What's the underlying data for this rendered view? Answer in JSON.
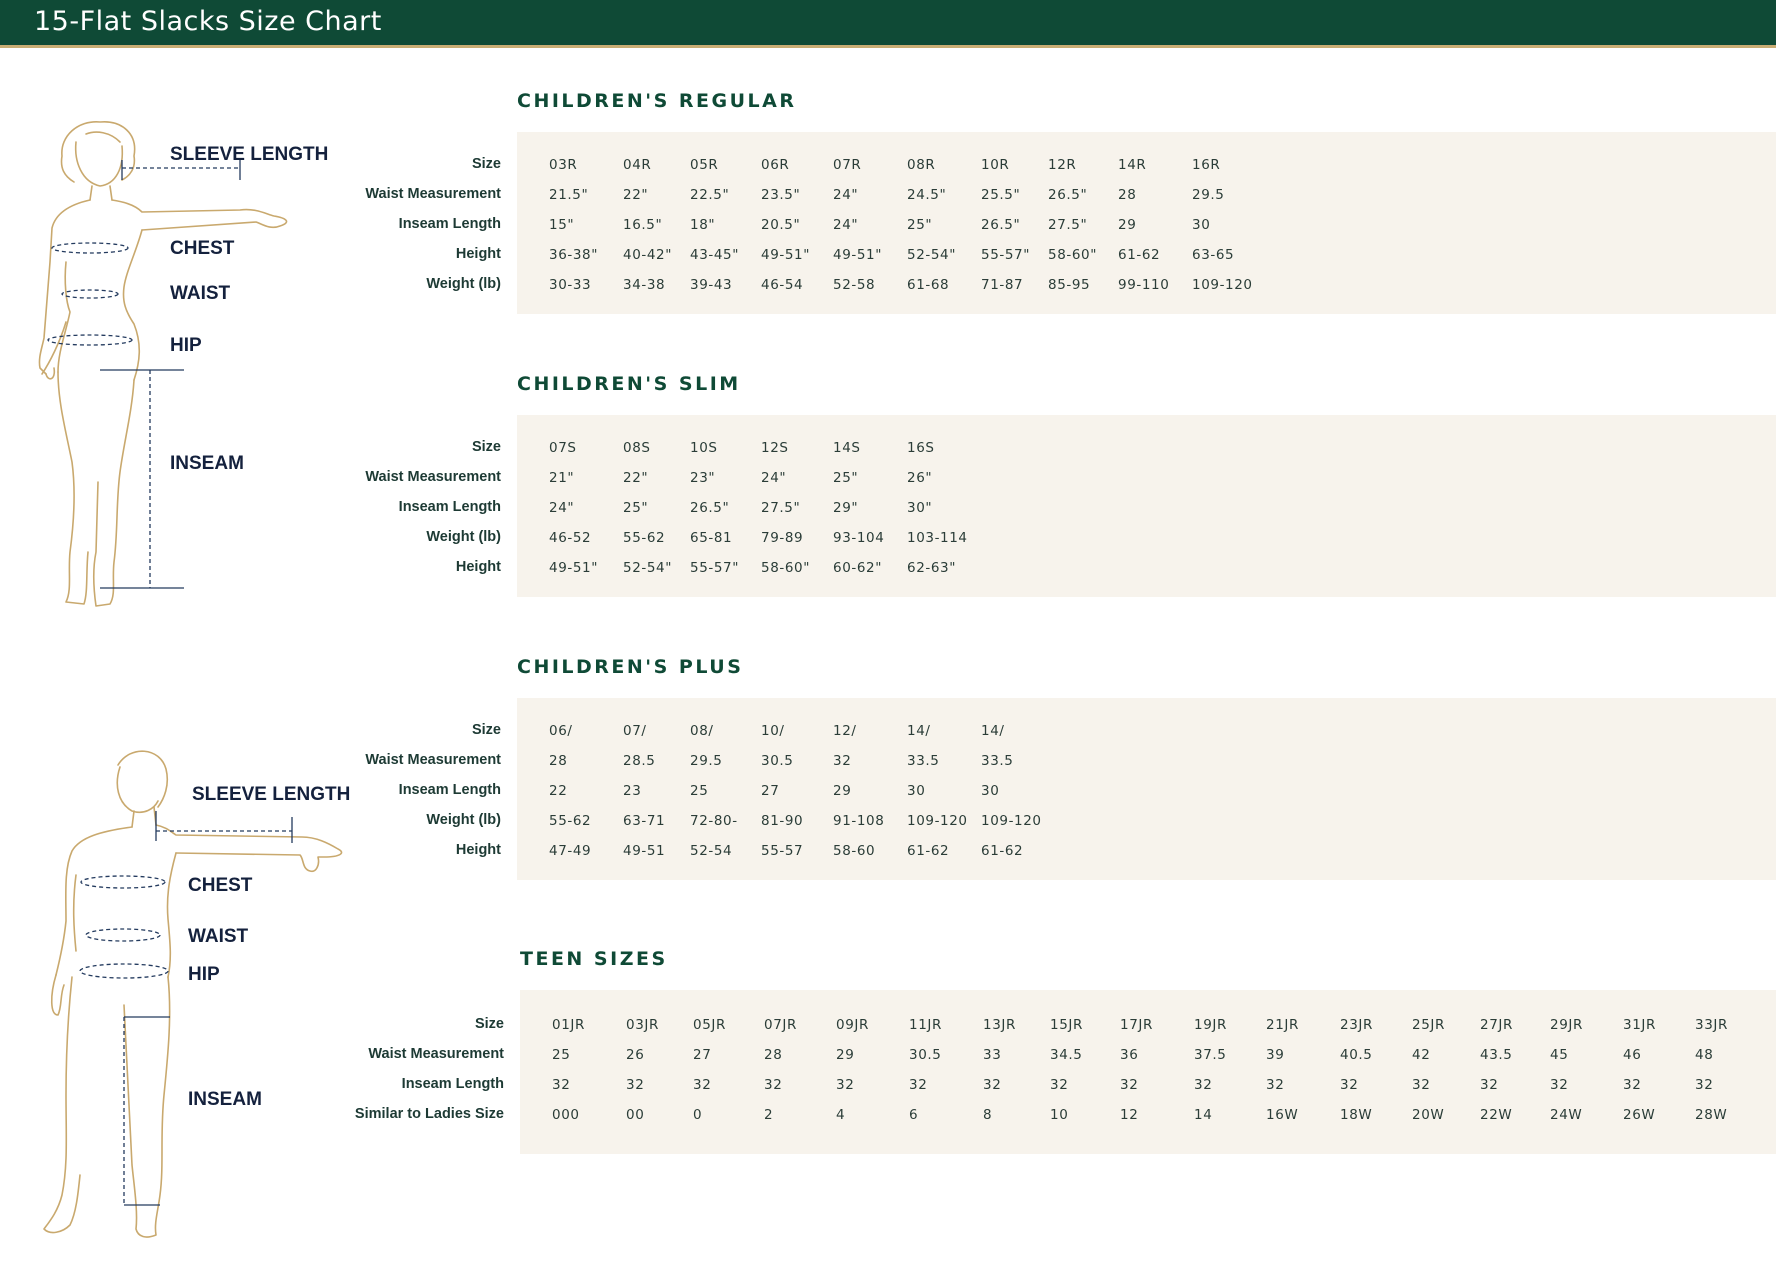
{
  "page": {
    "title": "15-Flat Slacks Size Chart"
  },
  "figures": {
    "child": {
      "labels": [
        "SLEEVE LENGTH",
        "CHEST",
        "WAIST",
        "HIP",
        "INSEAM"
      ]
    },
    "teen": {
      "labels": [
        "SLEEVE LENGTH",
        "CHEST",
        "WAIST",
        "HIP",
        "INSEAM"
      ]
    }
  },
  "tables": [
    {
      "title": "CHILDREN'S  REGULAR",
      "rows": [
        {
          "label": "Size",
          "values": [
            "03R",
            "04R",
            "05R",
            "06R",
            "07R",
            "08R",
            "10R",
            "12R",
            "14R",
            "16R"
          ]
        },
        {
          "label": "Waist Measurement",
          "values": [
            "21.5\"",
            "22\"",
            "22.5\"",
            "23.5\"",
            "24\"",
            "24.5\"",
            "25.5\"",
            "26.5\"",
            "28",
            "29.5"
          ]
        },
        {
          "label": "Inseam Length",
          "values": [
            "15\"",
            "16.5\"",
            "18\"",
            "20.5\"",
            "24\"",
            "25\"",
            "26.5\"",
            "27.5\"",
            "29",
            "30"
          ]
        },
        {
          "label": "Height",
          "values": [
            "36-38\"",
            "40-42\"",
            "43-45\"",
            "49-51\"",
            "49-51\"",
            "52-54\"",
            "55-57\"",
            "58-60\"",
            "61-62",
            "63-65"
          ]
        },
        {
          "label": "Weight (lb)",
          "values": [
            "30-33",
            "34-38",
            "39-43",
            "46-54",
            "52-58",
            "61-68",
            "71-87",
            "85-95",
            "99-110",
            "109-120"
          ]
        }
      ]
    },
    {
      "title": "CHILDREN'S  SLIM",
      "rows": [
        {
          "label": "Size",
          "values": [
            "07S",
            "08S",
            "10S",
            "12S",
            "14S",
            "16S"
          ]
        },
        {
          "label": "Waist Measurement",
          "values": [
            "21\"",
            "22\"",
            "23\"",
            "24\"",
            "25\"",
            "26\""
          ]
        },
        {
          "label": "Inseam Length",
          "values": [
            "24\"",
            "25\"",
            "26.5\"",
            "27.5\"",
            "29\"",
            "30\""
          ]
        },
        {
          "label": "Weight (lb)",
          "values": [
            "46-52",
            "55-62",
            "65-81",
            "79-89",
            "93-104",
            "103-114"
          ]
        },
        {
          "label": "Height",
          "values": [
            "49-51\"",
            "52-54\"",
            "55-57\"",
            "58-60\"",
            "60-62\"",
            "62-63\""
          ]
        }
      ]
    },
    {
      "title": "CHILDREN'S  PLUS",
      "rows": [
        {
          "label": "Size",
          "values": [
            "06/",
            "07/",
            "08/",
            "10/",
            "12/",
            "14/",
            "14/"
          ]
        },
        {
          "label": "Waist Measurement",
          "values": [
            "28",
            "28.5",
            "29.5",
            "30.5",
            "32",
            "33.5",
            "33.5"
          ]
        },
        {
          "label": "Inseam Length",
          "values": [
            "22",
            "23",
            "25",
            "27",
            "29",
            "30",
            "30"
          ]
        },
        {
          "label": "Weight (lb)",
          "values": [
            "55-62",
            "63-71",
            "72-80-",
            "81-90",
            "91-108",
            "109-120",
            "109-120"
          ]
        },
        {
          "label": "Height",
          "values": [
            "47-49",
            "49-51",
            "52-54",
            "55-57",
            "58-60",
            "61-62",
            "61-62"
          ]
        }
      ]
    },
    {
      "title": "TEEN SIZES",
      "rows": [
        {
          "label": "Size",
          "values": [
            "01JR",
            "03JR",
            "05JR",
            "07JR",
            "09JR",
            "11JR",
            "13JR",
            "15JR",
            "17JR",
            "19JR",
            "21JR",
            "23JR",
            "25JR",
            "27JR",
            "29JR",
            "31JR",
            "33JR"
          ]
        },
        {
          "label": "Waist Measurement",
          "values": [
            "25",
            "26",
            "27",
            "28",
            "29",
            "30.5",
            "33",
            "34.5",
            "36",
            "37.5",
            "39",
            "40.5",
            "42",
            "43.5",
            "45",
            "46",
            "48"
          ]
        },
        {
          "label": "Inseam Length",
          "values": [
            "32",
            "32",
            "32",
            "32",
            "32",
            "32",
            "32",
            "32",
            "32",
            "32",
            "32",
            "32",
            "32",
            "32",
            "32",
            "32",
            "32"
          ]
        },
        {
          "label": "Similar to Ladies Size",
          "values": [
            "000",
            "00",
            "0",
            "2",
            "4",
            "6",
            "8",
            "10",
            "12",
            "14",
            "16W",
            "18W",
            "20W",
            "22W",
            "24W",
            "26W",
            "28W"
          ]
        }
      ]
    }
  ]
}
